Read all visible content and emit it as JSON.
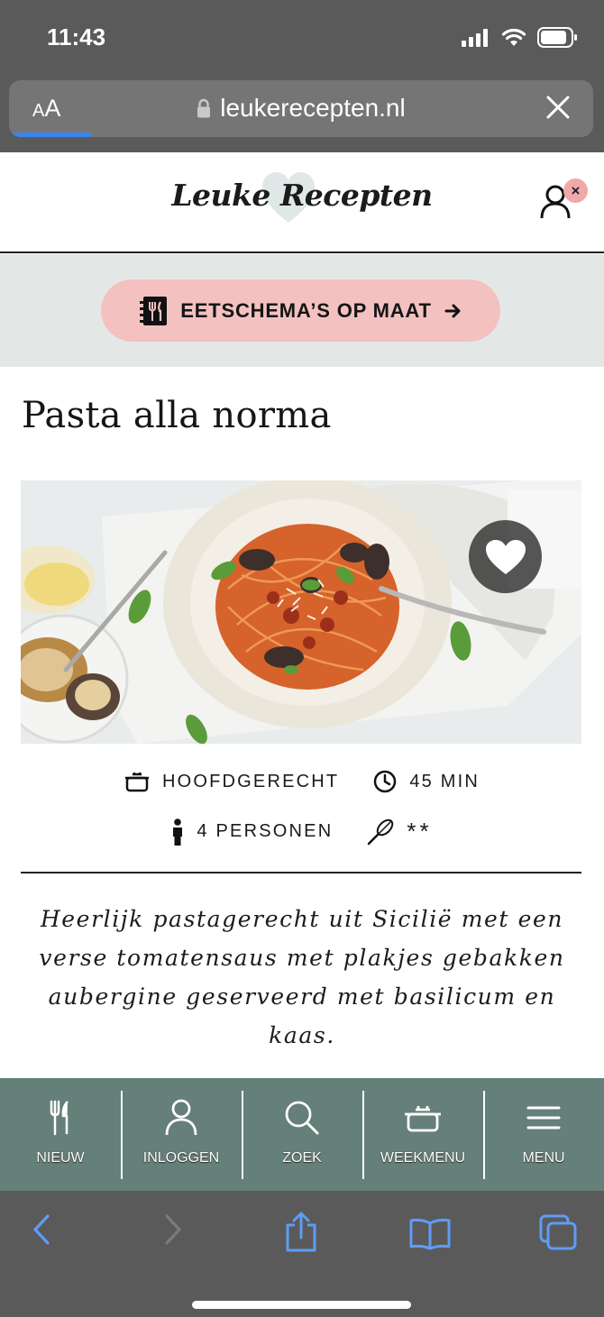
{
  "status_bar": {
    "time": "11:43",
    "icons": [
      "signal-icon",
      "wifi-icon",
      "battery-icon"
    ]
  },
  "browser": {
    "text_size_small": "A",
    "text_size_large": "A",
    "url": "leukerecepten.nl",
    "load_progress": 0.14,
    "accent_color": "#3a84f0"
  },
  "site_header": {
    "logo_text": "Leuke Recepten",
    "account_badge": "×"
  },
  "promo": {
    "label": "EETSCHEMA’S OP MAAT",
    "icon": "meal-plan-icon",
    "arrow": "→",
    "color": "#f4c1c1"
  },
  "recipe": {
    "title": "Pasta alla norma",
    "meta": {
      "course": "HOOFDGERECHT",
      "time": "45 MIN",
      "servings": "4 PERSONEN",
      "difficulty": "**"
    },
    "intro": "Heerlijk pastagerecht uit Sicilië met een verse tomatensaus met plakjes gebakken aubergine geserveerd met basilicum en kaas."
  },
  "bottom_nav": {
    "color": "#657f79",
    "items": [
      {
        "label": "NIEUW",
        "icon": "fork-knife-icon"
      },
      {
        "label": "INLOGGEN",
        "icon": "user-icon"
      },
      {
        "label": "ZOEK",
        "icon": "search-icon"
      },
      {
        "label": "WEEKMENU",
        "icon": "pot-icon"
      },
      {
        "label": "MENU",
        "icon": "hamburger-icon"
      }
    ]
  },
  "safari_toolbar": {
    "icons": [
      "back-icon",
      "forward-icon",
      "share-icon",
      "bookmarks-icon",
      "tabs-icon"
    ]
  }
}
